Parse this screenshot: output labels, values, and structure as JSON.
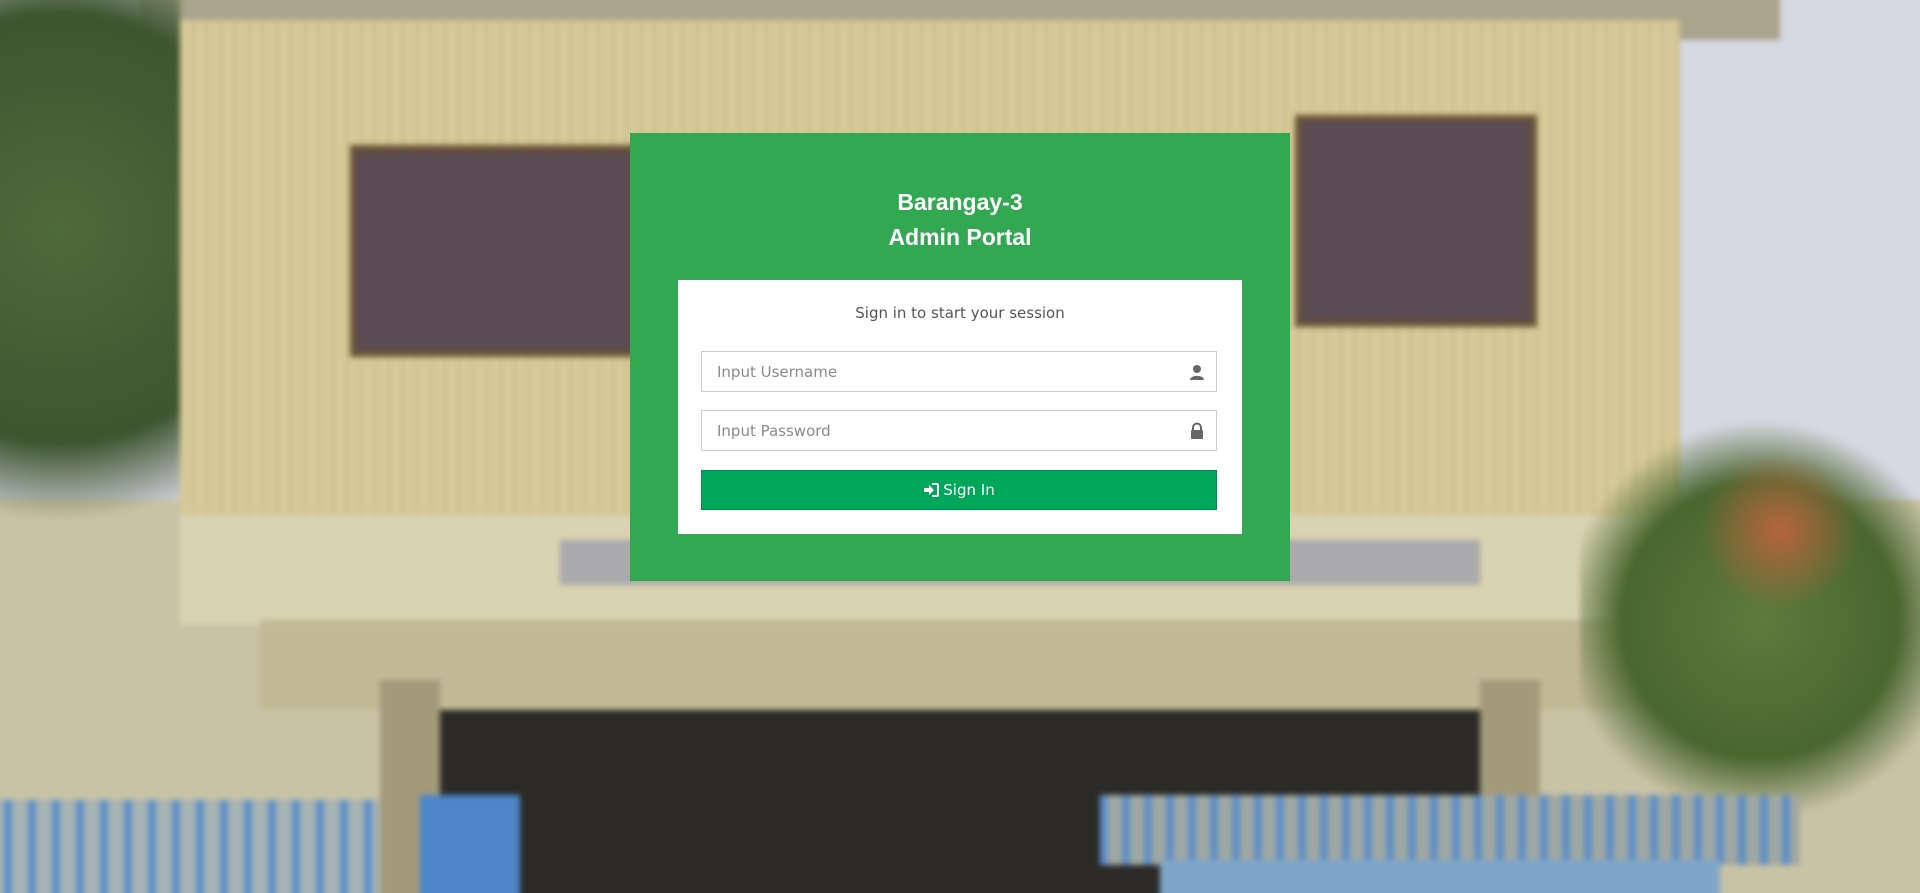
{
  "portal": {
    "title_line1": "Barangay-3",
    "title_line2": "Admin Portal"
  },
  "login": {
    "message": "Sign in to start your session",
    "username_placeholder": "Input Username",
    "password_placeholder": "Input Password",
    "signin_label": "Sign In"
  },
  "icons": {
    "username": "user-icon",
    "password": "lock-icon",
    "signin": "sign-in-icon"
  },
  "colors": {
    "panel": "#32a852",
    "button": "#00a65a"
  }
}
